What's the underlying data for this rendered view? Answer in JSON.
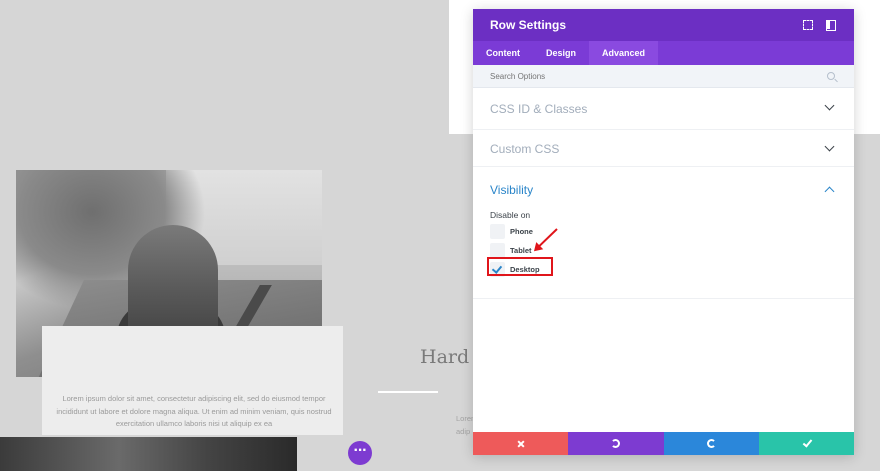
{
  "page": {
    "heading": "Hard",
    "card_text": "Lorem ipsum dolor sit amet, consectetur adipiscing elit, sed do eiusmod tempor incididunt ut labore et dolore magna aliqua. Ut enim ad minim veniam, quis nostrud exercitation ullamco laboris nisi ut aliquip ex ea",
    "right_text_line1": "Lorem",
    "right_text_line2": "adip"
  },
  "modal": {
    "title": "Row Settings",
    "tabs": [
      {
        "label": "Content"
      },
      {
        "label": "Design"
      },
      {
        "label": "Advanced"
      }
    ],
    "active_tab": "Advanced",
    "search": {
      "placeholder": "Search Options",
      "value": ""
    },
    "sections": {
      "css_id": {
        "title": "CSS ID & Classes"
      },
      "custom_css": {
        "title": "Custom CSS"
      },
      "visibility": {
        "title": "Visibility",
        "disable_on_label": "Disable on",
        "options": [
          {
            "label": "Phone",
            "checked": false
          },
          {
            "label": "Tablet",
            "checked": false
          },
          {
            "label": "Desktop",
            "checked": true
          }
        ]
      }
    },
    "footer": {
      "cancel_icon": "close-icon",
      "undo_icon": "undo-icon",
      "redo_icon": "redo-icon",
      "save_icon": "check-icon"
    }
  },
  "colors": {
    "header": "#6c2fc3",
    "tabs": "#7b3bd6",
    "accent_blue": "#2a85c9",
    "cancel": "#ee5a5a",
    "undo": "#7d3bd1",
    "redo": "#2b87da",
    "save": "#29c4a9",
    "annotation": "#e0151b"
  }
}
